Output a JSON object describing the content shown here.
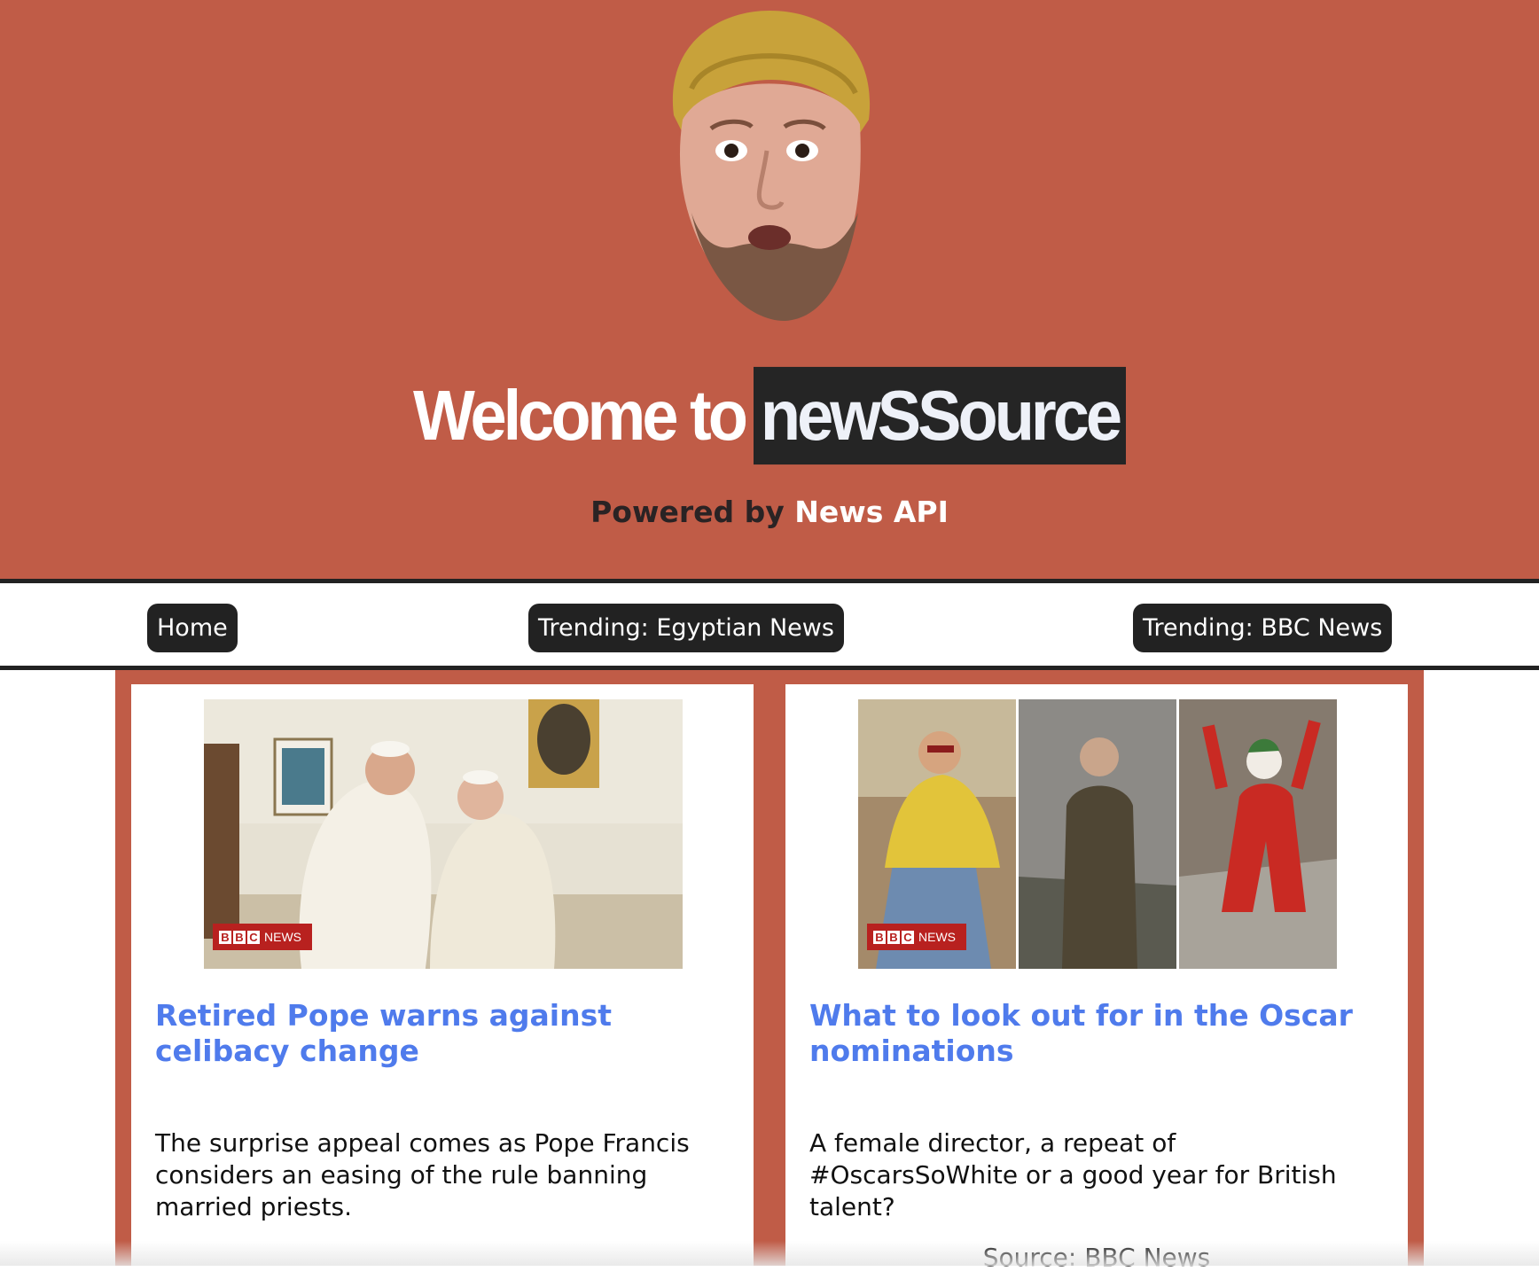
{
  "header": {
    "title_prefix": "Welcome to",
    "title_brand": "newSSource",
    "powered_prefix": "Powered by",
    "powered_link": "News API",
    "avatar_icon": "face-avatar-icon",
    "colors": {
      "hero_bg": "#c05c47",
      "brand_bg": "#252525",
      "link": "#4f7bec"
    }
  },
  "nav": {
    "home": "Home",
    "trending_egypt": "Trending: Egyptian News",
    "trending_bbc": "Trending: BBC News"
  },
  "articles": [
    {
      "title": "Retired Pope warns against celibacy change",
      "description": "The surprise appeal comes as Pope Francis considers an easing of the rule banning married priests.",
      "source": "",
      "image_badge": {
        "logo": "BBC",
        "label": "NEWS"
      }
    },
    {
      "title": "What to look out for in the Oscar nominations",
      "description": "A female director, a repeat of #OscarsSoWhite or a good year for British talent?",
      "source": "Source: BBC News",
      "image_badge": {
        "logo": "BBC",
        "label": "NEWS"
      }
    }
  ]
}
